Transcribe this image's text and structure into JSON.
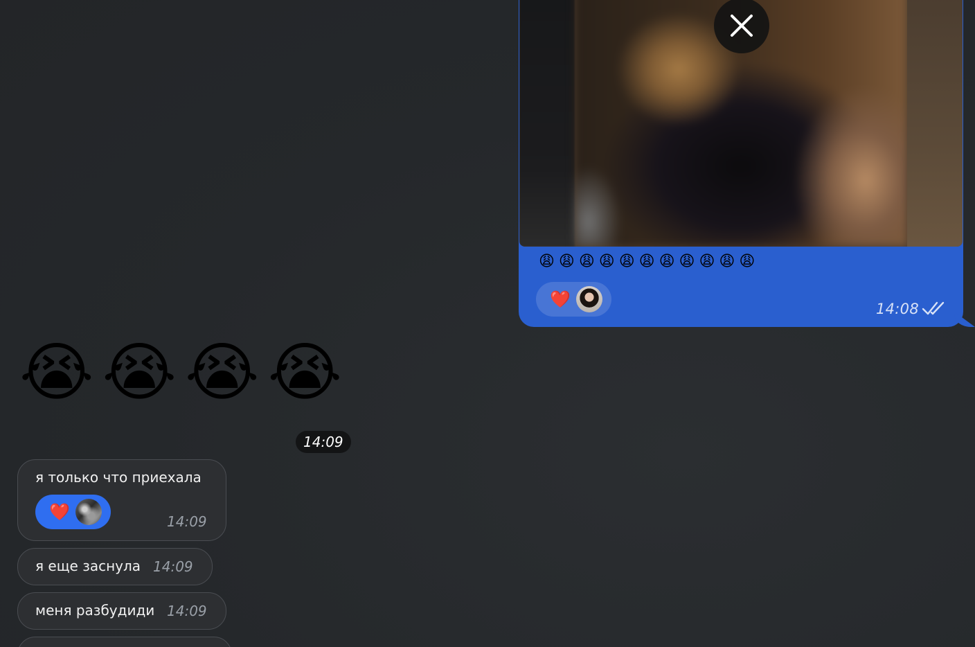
{
  "outgoing_media_message": {
    "close_icon": "close-icon",
    "emojis": "😩😩😩😩😩😩😩😩😩😩😩",
    "reaction": {
      "emoji": "❤️",
      "avatar_icon": "user-avatar"
    },
    "time": "14:08",
    "status_icon": "double-check-icon",
    "bubble_color": "#2a5fcf"
  },
  "incoming": {
    "big_emoji": "😭😭😭😭",
    "big_emoji_time": "14:09",
    "messages": [
      {
        "text": "я только что приехала",
        "time": "14:09",
        "reaction": {
          "emoji": "❤️",
          "avatar_icon": "user-avatar"
        }
      },
      {
        "text": "я еще заснула",
        "time": "14:09"
      },
      {
        "text": "меня разбудиди",
        "time": "14:09"
      }
    ]
  },
  "colors": {
    "background": "#25282b",
    "incoming_bubble": "#2d2f32",
    "reaction_blue": "#2f6ef0"
  }
}
